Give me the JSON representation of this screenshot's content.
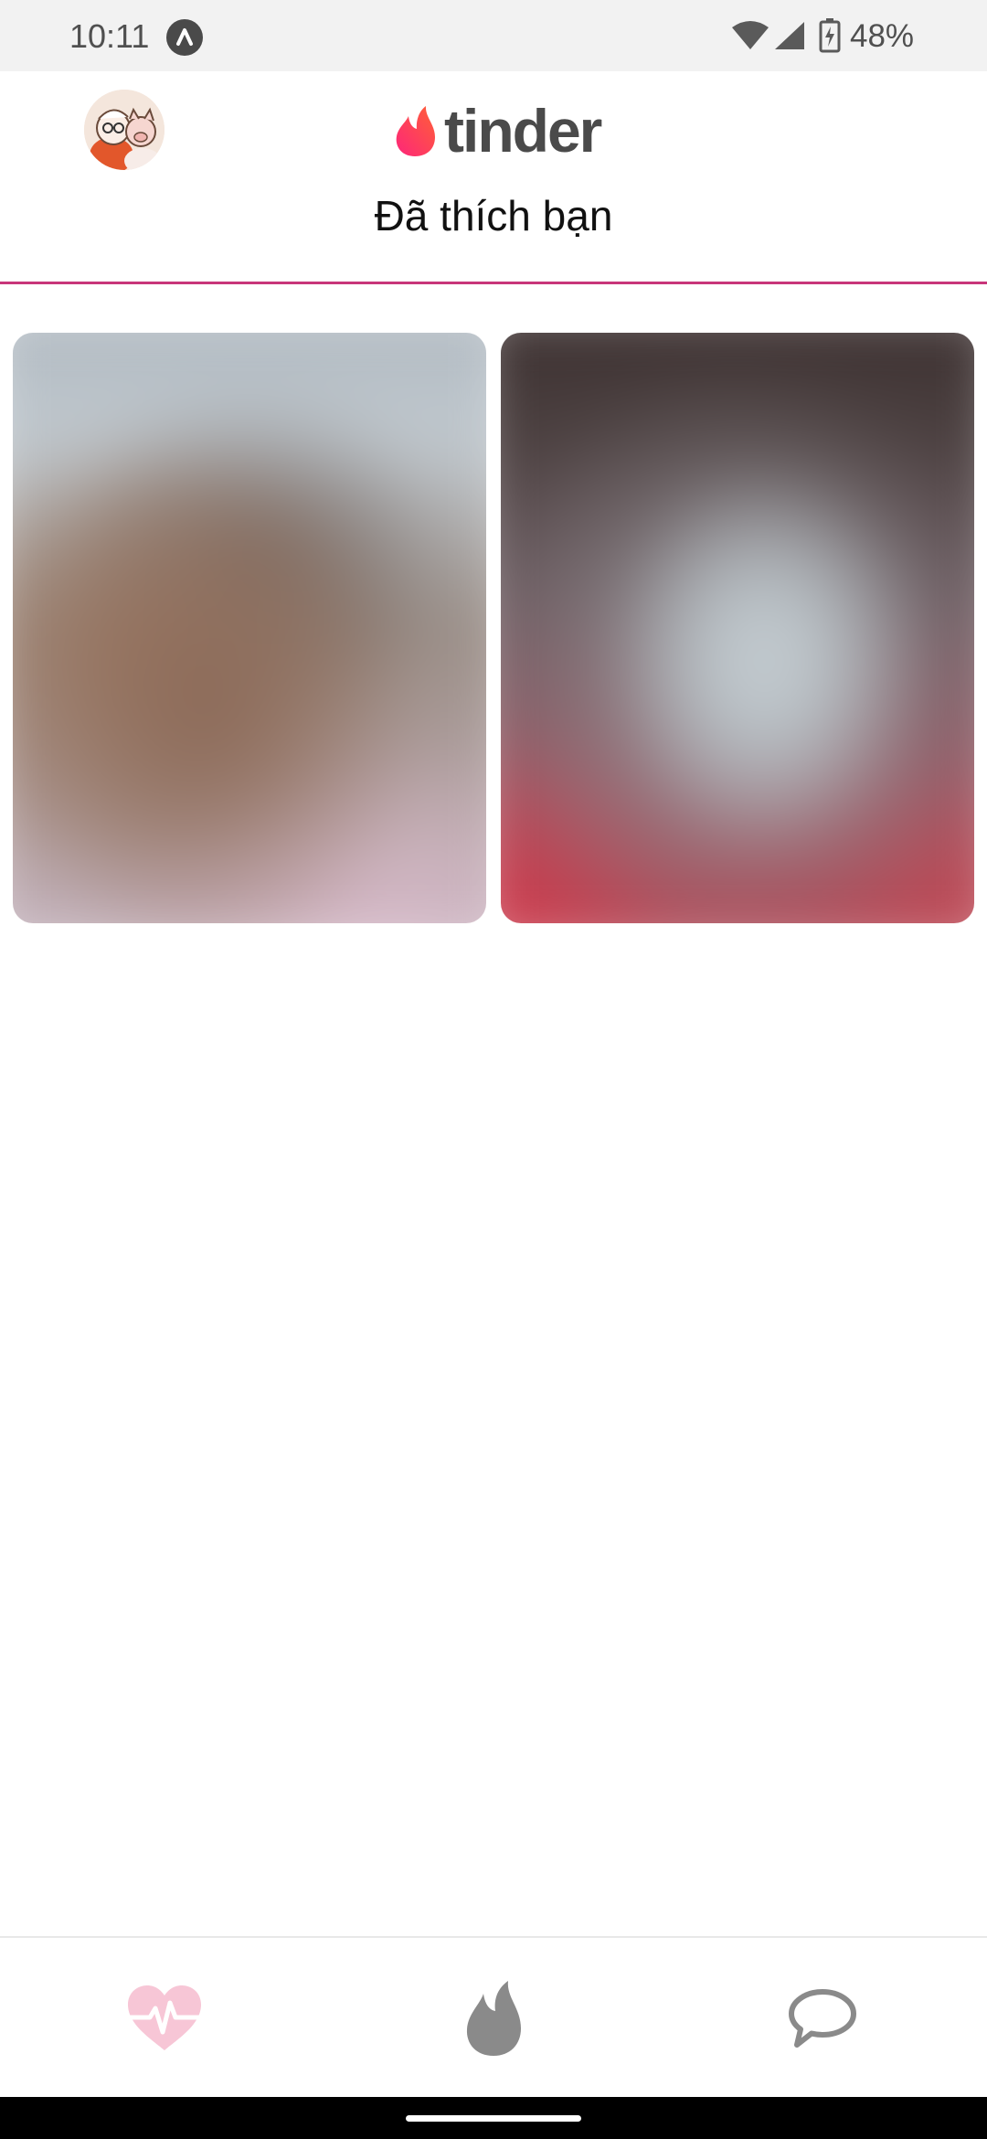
{
  "status_bar": {
    "time": "10:11",
    "battery_text": "48%",
    "icons": [
      "app-notification-icon",
      "wifi-icon",
      "cell-signal-icon",
      "battery-charging-icon"
    ]
  },
  "header": {
    "logo_text": "tinder",
    "title": "Đã thích bạn",
    "accent_color": "#c8357a"
  },
  "cards": [
    {
      "name": "blurred-profile-card-1"
    },
    {
      "name": "blurred-profile-card-2"
    }
  ],
  "bottom_nav": {
    "items": [
      {
        "icon": "heart-pulse-icon",
        "active": true,
        "color": "#f7c6d6"
      },
      {
        "icon": "flame-icon",
        "active": false,
        "color": "#8a8a8a"
      },
      {
        "icon": "chat-bubble-icon",
        "active": false,
        "color": "#8a8a8a"
      }
    ]
  },
  "colors": {
    "brand_gradient_start": "#fd267a",
    "brand_gradient_end": "#ff6036",
    "status_bar_bg": "#f2f2f2"
  }
}
